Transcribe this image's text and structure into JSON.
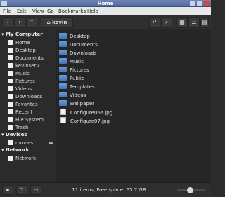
{
  "window": {
    "title": "Home"
  },
  "menu": [
    "File",
    "Edit",
    "View",
    "Go",
    "Bookmarks",
    "Help"
  ],
  "toolbar": {
    "path_label": "kevin"
  },
  "sidebar": {
    "sections": [
      {
        "title": "My Computer",
        "items": [
          "Home",
          "Desktop",
          "Documents",
          "kevinserv",
          "Music",
          "Pictures",
          "Videos",
          "Downloads",
          "Favorites",
          "Recent",
          "File System",
          "Trash"
        ]
      },
      {
        "title": "Devices",
        "items": [
          "movies"
        ]
      },
      {
        "title": "Network",
        "items": [
          "Network"
        ]
      }
    ]
  },
  "files": [
    {
      "name": "Desktop",
      "kind": "folder"
    },
    {
      "name": "Documents",
      "kind": "folder"
    },
    {
      "name": "Downloads",
      "kind": "folder"
    },
    {
      "name": "Music",
      "kind": "folder"
    },
    {
      "name": "Pictures",
      "kind": "folder"
    },
    {
      "name": "Public",
      "kind": "folder"
    },
    {
      "name": "Templates",
      "kind": "folder"
    },
    {
      "name": "Videos",
      "kind": "folder"
    },
    {
      "name": "Wallpaper",
      "kind": "folder"
    },
    {
      "name": "Configure06a.jpg",
      "kind": "file"
    },
    {
      "name": "Configure07.jpg",
      "kind": "file"
    }
  ],
  "status": {
    "text": "11 items, Free space: 65.7 GB"
  },
  "zoom": {
    "level": 0.4
  }
}
